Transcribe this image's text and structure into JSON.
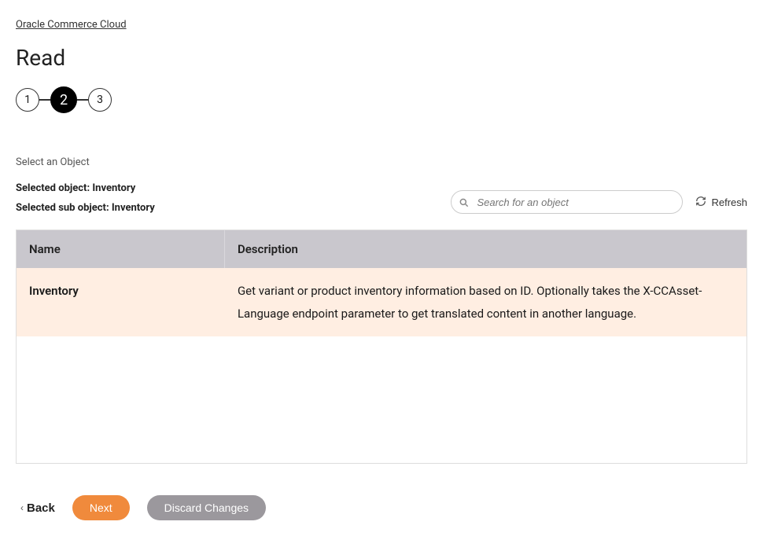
{
  "breadcrumb": "Oracle Commerce Cloud",
  "title": "Read",
  "steps": [
    "1",
    "2",
    "3"
  ],
  "active_step_index": 1,
  "section_label": "Select an Object",
  "selected_object_label": "Selected object: ",
  "selected_object_value": "Inventory",
  "selected_sub_object_label": "Selected sub object: ",
  "selected_sub_object_value": "Inventory",
  "search_placeholder": "Search for an object",
  "refresh_label": "Refresh",
  "table": {
    "headers": [
      "Name",
      "Description"
    ],
    "rows": [
      {
        "name": "Inventory",
        "description": "Get variant or product inventory information based on ID. Optionally takes the X-CCAsset-Language endpoint parameter to get translated content in another language."
      }
    ]
  },
  "actions": {
    "back": "Back",
    "next": "Next",
    "discard": "Discard Changes"
  }
}
